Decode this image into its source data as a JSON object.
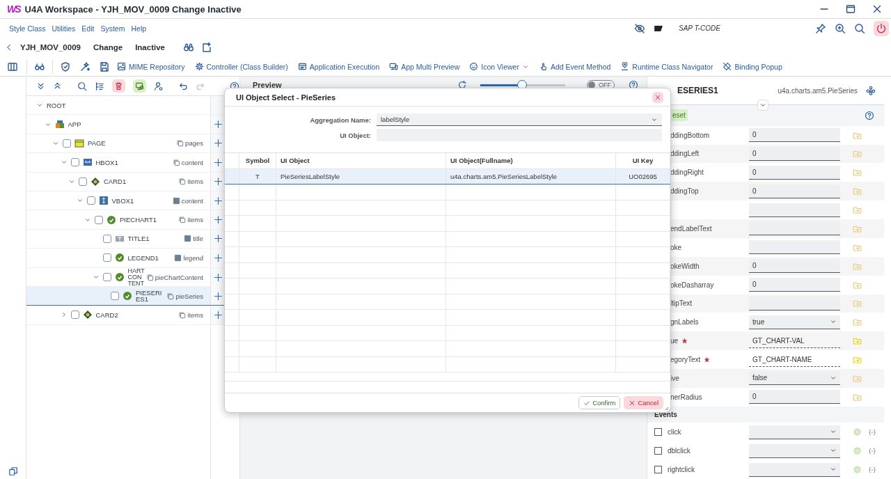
{
  "window": {
    "logo": "WS",
    "title": "U4A Workspace - YJH_MOV_0009 Change Inactive"
  },
  "menu": [
    "Style Class",
    "Utilities",
    "Edit",
    "System",
    "Help"
  ],
  "tcode": {
    "placeholder": "SAP T-CODE"
  },
  "header": {
    "app_id": "YJH_MOV_0009",
    "mode": "Change",
    "status": "Inactive"
  },
  "toolbar": [
    {
      "label": "MIME Repository",
      "kind": "image",
      "menu": false
    },
    {
      "label": "Controller (Class Builder)",
      "kind": "gear",
      "menu": false
    },
    {
      "label": "Application Execution",
      "kind": "run",
      "menu": false
    },
    {
      "label": "App Multi Preview",
      "kind": "devices",
      "menu": false
    },
    {
      "label": "Icon Viewer",
      "kind": "smiley",
      "menu": true
    },
    {
      "label": "Add Event Method",
      "kind": "touch",
      "menu": false
    },
    {
      "label": "Runtime Class Navigator",
      "kind": "pin",
      "menu": false
    },
    {
      "label": "Binding Popup",
      "kind": "unlink",
      "menu": false
    }
  ],
  "tree": {
    "nodes": [
      {
        "name": "ROOT",
        "kind": "root",
        "expanded": true,
        "selected": false,
        "children": [
          {
            "name": "APP",
            "kind": "app",
            "expanded": true,
            "selected": false,
            "children": [
              {
                "name": "PAGE",
                "kind": "page",
                "checked": false,
                "aggregation": "pages",
                "multiple": true,
                "expanded": true,
                "selected": false,
                "children": [
                  {
                    "name": "HBOX1",
                    "kind": "hbox",
                    "checked": false,
                    "aggregation": "content",
                    "multiple": true,
                    "expanded": true,
                    "selected": false,
                    "children": [
                      {
                        "name": "CARD1",
                        "kind": "card",
                        "checked": false,
                        "aggregation": "items",
                        "multiple": true,
                        "expanded": true,
                        "selected": false,
                        "children": [
                          {
                            "name": "VBOX1",
                            "kind": "vbox",
                            "checked": false,
                            "aggregation": "content",
                            "multiple": false,
                            "expanded": true,
                            "selected": false,
                            "children": [
                              {
                                "name": "PIECHART1",
                                "kind": "chart",
                                "checked": false,
                                "aggregation": "items",
                                "multiple": true,
                                "expanded": true,
                                "selected": false,
                                "children": [
                                  {
                                    "name": "TITLE1",
                                    "kind": "title",
                                    "checked": false,
                                    "aggregation": "title",
                                    "multiple": false,
                                    "selected": false
                                  },
                                  {
                                    "name": "LEGEND1",
                                    "kind": "chart",
                                    "checked": false,
                                    "aggregation": "legend",
                                    "multiple": false,
                                    "selected": false
                                  },
                                  {
                                    "name": "HART CON TENT",
                                    "kind": "chart",
                                    "checked": false,
                                    "aggregation": "pieChartContent",
                                    "multiple": true,
                                    "expanded": true,
                                    "selected": false,
                                    "children": [
                                      {
                                        "name": "PIESERIES1",
                                        "kind": "chart",
                                        "checked": false,
                                        "aggregation": "pieSeries",
                                        "multiple": true,
                                        "selected": true
                                      }
                                    ]
                                  }
                                ]
                              }
                            ]
                          }
                        ]
                      }
                    ]
                  },
                  {
                    "name": "CARD2",
                    "kind": "card",
                    "checked": false,
                    "aggregation": "items",
                    "multiple": true,
                    "expanded": false,
                    "selected": false
                  }
                ]
              }
            ]
          }
        ]
      }
    ]
  },
  "preview": {
    "title": "Preview",
    "zoom": {
      "level": 0.49
    },
    "live": {
      "on": false,
      "label": "OFF"
    }
  },
  "dialog": {
    "title": "UI Object Select - PieSeries",
    "fields": [
      {
        "label": "Aggregation Name:",
        "value": "labelStyle",
        "kind": "select"
      },
      {
        "label": "UI Object:",
        "kind": "input"
      }
    ],
    "columns": [
      "Symbol",
      "UI Object",
      "UI Object(Fullname)",
      "UI Key"
    ],
    "rows": [
      {
        "cells": [
          "T",
          "PieSeriesLabelStyle",
          "u4a.charts.am5.PieSeriesLabelStyle",
          "UO02695"
        ],
        "selected": true
      }
    ],
    "buttons": [
      {
        "label": "Confirm",
        "kind": "confirm"
      },
      {
        "label": "Cancel",
        "kind": "cancel"
      }
    ]
  },
  "properties": {
    "title": "ESERIES1",
    "class_name": "u4a.charts.am5.PieSeries",
    "reset": "eset",
    "rows": [
      {
        "label": "ddingBottom",
        "value": "0",
        "kind": "input",
        "bound": false,
        "required": false
      },
      {
        "label": "ddingLeft",
        "value": "0",
        "kind": "input",
        "bound": false,
        "required": false
      },
      {
        "label": "ddingRight",
        "value": "0",
        "kind": "input",
        "bound": false,
        "required": false
      },
      {
        "label": "ddingTop",
        "value": "0",
        "kind": "input",
        "bound": false,
        "required": false
      },
      {
        "kind": "input",
        "bound": false,
        "required": false
      },
      {
        "label": "endLabelText",
        "kind": "input",
        "bound": false,
        "required": false
      },
      {
        "label": "oke",
        "kind": "input",
        "bound": false,
        "required": false
      },
      {
        "label": "okeWidth",
        "value": "0",
        "kind": "input",
        "bound": false,
        "required": false
      },
      {
        "label": "okeDasharray",
        "value": "0",
        "kind": "input",
        "bound": false,
        "required": false
      },
      {
        "label": "ltipText",
        "kind": "input",
        "bound": false,
        "required": false
      },
      {
        "label": "gnLabels",
        "value": "true",
        "kind": "select",
        "bound": false,
        "required": false
      },
      {
        "label": "ue",
        "value": "GT_CHART-VAL",
        "kind": "input",
        "bound": true,
        "required": true
      },
      {
        "label": "egoryText",
        "value": "GT_CHART-NAME",
        "kind": "input",
        "bound": true,
        "required": true
      },
      {
        "label": "ive",
        "value": "false",
        "kind": "select",
        "bound": false,
        "required": false
      },
      {
        "label": "nerRadius",
        "value": "0",
        "kind": "input",
        "bound": false,
        "required": false
      }
    ],
    "events_title": "Events",
    "events": [
      {
        "label": "click",
        "checked": false
      },
      {
        "label": "dblclick",
        "checked": false
      },
      {
        "label": "rightclick",
        "checked": false
      }
    ]
  }
}
